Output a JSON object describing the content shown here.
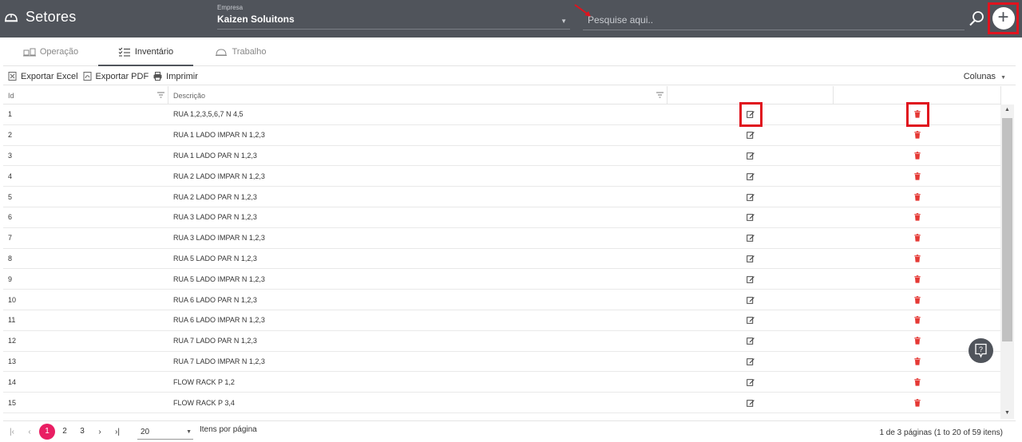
{
  "header": {
    "title": "Setores",
    "empresa_label": "Empresa",
    "empresa_value": "Kaizen Soluitons",
    "search_placeholder": "Pesquise aqui..",
    "add_label": "+"
  },
  "tabs": [
    {
      "label": "Operação",
      "icon": "scale-icon",
      "active": false
    },
    {
      "label": "Inventário",
      "icon": "checklist-icon",
      "active": true
    },
    {
      "label": "Trabalho",
      "icon": "helmet-icon",
      "active": false
    }
  ],
  "toolbar": {
    "export_excel": "Exportar Excel",
    "export_pdf": "Exportar PDF",
    "print": "Imprimir",
    "columns": "Colunas"
  },
  "grid": {
    "headers": [
      "Id",
      "Descrição",
      "",
      ""
    ],
    "rows": [
      {
        "id": "1",
        "desc": "RUA 1,2,3,5,6,7 N 4,5"
      },
      {
        "id": "2",
        "desc": "RUA 1 LADO IMPAR N 1,2,3"
      },
      {
        "id": "3",
        "desc": "RUA 1 LADO PAR N 1,2,3"
      },
      {
        "id": "4",
        "desc": "RUA 2 LADO IMPAR N 1,2,3"
      },
      {
        "id": "5",
        "desc": "RUA 2 LADO PAR N 1,2,3"
      },
      {
        "id": "6",
        "desc": "RUA 3 LADO PAR N 1,2,3"
      },
      {
        "id": "7",
        "desc": "RUA 3 LADO IMPAR N 1,2,3"
      },
      {
        "id": "8",
        "desc": "RUA 5 LADO PAR N 1,2,3"
      },
      {
        "id": "9",
        "desc": "RUA 5 LADO IMPAR N 1,2,3"
      },
      {
        "id": "10",
        "desc": "RUA 6 LADO PAR N 1,2,3"
      },
      {
        "id": "11",
        "desc": "RUA 6 LADO IMPAR N 1,2,3"
      },
      {
        "id": "12",
        "desc": "RUA 7 LADO PAR N 1,2,3"
      },
      {
        "id": "13",
        "desc": "RUA 7 LADO IMPAR N 1,2,3"
      },
      {
        "id": "14",
        "desc": "FLOW RACK P 1,2"
      },
      {
        "id": "15",
        "desc": "FLOW RACK P 3,4"
      }
    ]
  },
  "pager": {
    "pages": [
      "1",
      "2",
      "3"
    ],
    "current": "1",
    "page_size": "20",
    "page_size_label": "Itens por página",
    "info": "1 de 3 páginas (1 to 20 of 59 itens)"
  },
  "colors": {
    "header_bg": "#50545b",
    "highlight": "#e0131e",
    "delete_icon": "#e53935",
    "pager_active": "#e91e63"
  }
}
